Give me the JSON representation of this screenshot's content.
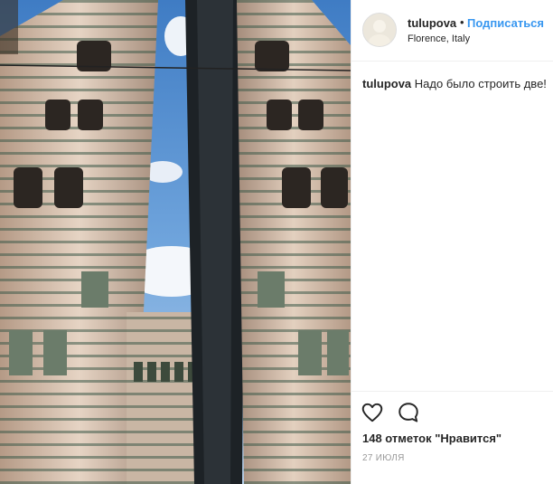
{
  "post": {
    "username": "tulupova",
    "separator": "•",
    "follow_label": "Подписаться",
    "location": "Florence, Italy",
    "caption": {
      "username": "tulupova",
      "text": "Надо было строить две!"
    },
    "likes_text": "148 отметок \"Нравится\"",
    "date": "27 ИЮЛЯ"
  },
  "icons": {
    "like": "heart-outline-icon",
    "comment": "comment-bubble-icon"
  },
  "colors": {
    "link_blue": "#3897f0",
    "text": "#262626",
    "muted": "#999999",
    "divider": "#efefef"
  }
}
